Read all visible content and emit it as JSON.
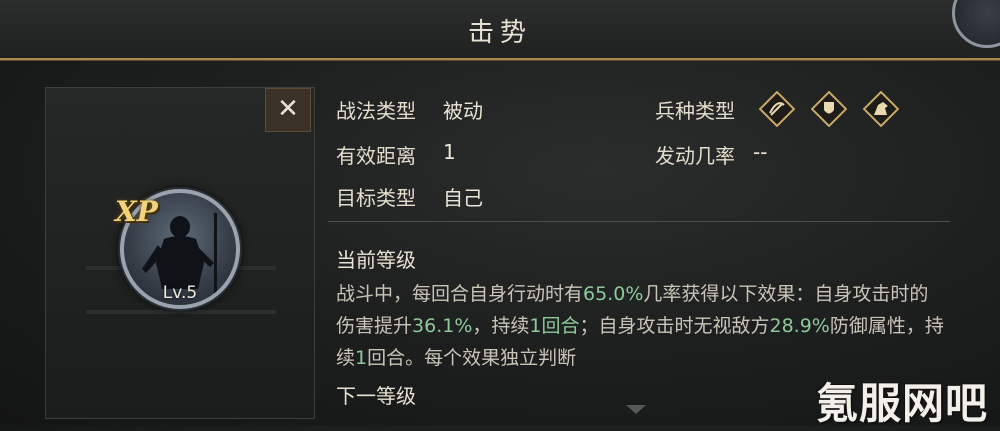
{
  "title": "击势",
  "close_label": "✕",
  "badge": {
    "xp": "XP",
    "level": "Lv.5"
  },
  "fields": {
    "tactic_type_label": "战法类型",
    "tactic_type_value": "被动",
    "range_label": "有效距离",
    "range_value": "1",
    "target_label": "目标类型",
    "target_value": "自己",
    "unit_type_label": "兵种类型",
    "trigger_rate_label": "发动几率",
    "trigger_rate_value": "--"
  },
  "unit_icons": [
    "bow-cavalry-icon",
    "shield-icon",
    "cavalry-icon"
  ],
  "current_level": {
    "title": "当前等级",
    "segments": [
      {
        "text": "战斗中，每回合自身行动时有",
        "hl": false
      },
      {
        "text": "65.0%",
        "hl": true
      },
      {
        "text": "几率获得以下效果：自身攻击时的伤害提升",
        "hl": false
      },
      {
        "text": "36.1%",
        "hl": true
      },
      {
        "text": "，持续",
        "hl": false
      },
      {
        "text": "1回合",
        "hl": true
      },
      {
        "text": "；自身攻击时无视敌方",
        "hl": false
      },
      {
        "text": "28.9%",
        "hl": true
      },
      {
        "text": "防御属性，持续",
        "hl": false
      },
      {
        "text": "1",
        "hl": true
      },
      {
        "text": "回合。每个效果独立判断",
        "hl": false
      }
    ]
  },
  "next_level": {
    "title": "下一等级"
  },
  "watermark": "氪服网吧",
  "colors": {
    "highlight": "#8fc99a",
    "gold_border": "#a88a54"
  }
}
